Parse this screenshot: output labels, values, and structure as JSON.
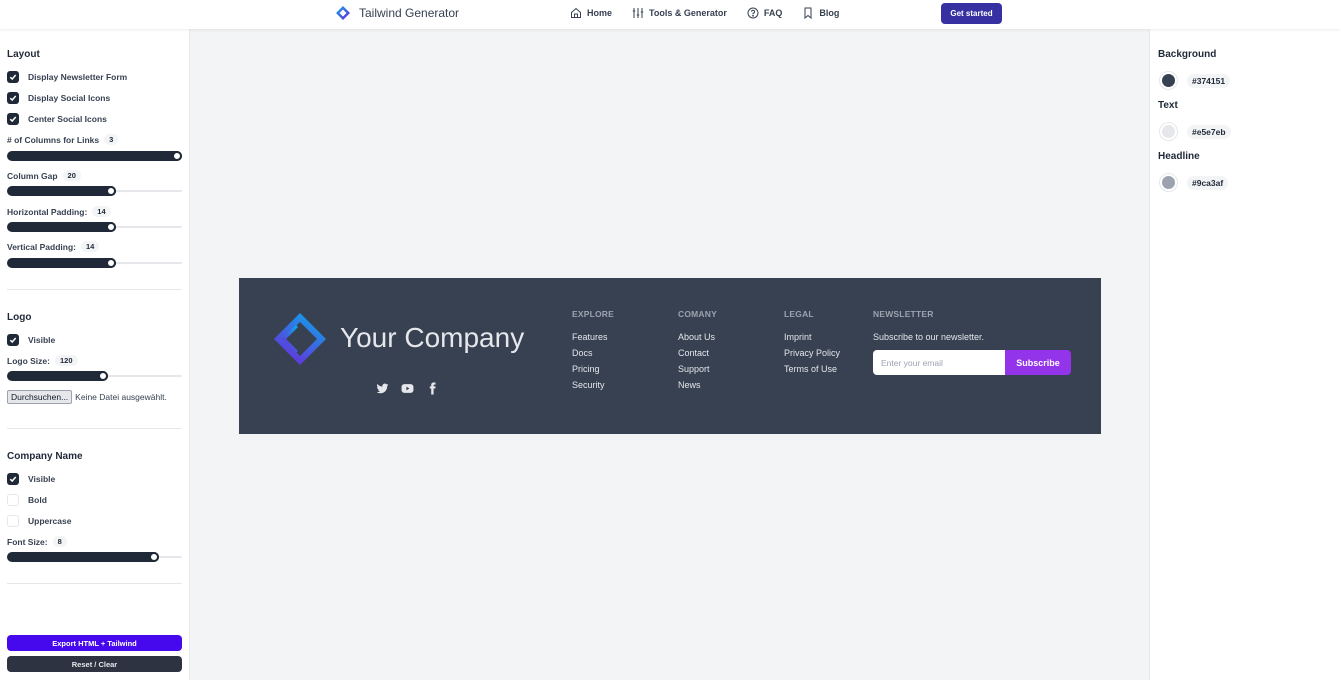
{
  "nav": {
    "brand": "Tailwind Generator",
    "links": [
      {
        "label": "Home",
        "icon": "home-icon"
      },
      {
        "label": "Tools & Generator",
        "icon": "sliders-icon"
      },
      {
        "label": "FAQ",
        "icon": "question-circle-icon"
      },
      {
        "label": "Blog",
        "icon": "bookmark-icon"
      }
    ],
    "cta": "Get started"
  },
  "left": {
    "layout": {
      "title": "Layout",
      "checkboxes": [
        {
          "label": "Display Newsletter Form",
          "checked": true
        },
        {
          "label": "Display Social Icons",
          "checked": true
        },
        {
          "label": "Center Social Icons",
          "checked": true
        }
      ],
      "sliders": [
        {
          "label": "# of Columns for Links",
          "value": "3",
          "fraction": 1.0
        },
        {
          "label": "Column Gap",
          "value": "20",
          "fraction": 0.6
        },
        {
          "label": "Horizontal Padding:",
          "value": "14",
          "fraction": 0.6
        },
        {
          "label": "Vertical Padding:",
          "value": "14",
          "fraction": 0.6
        }
      ]
    },
    "logo": {
      "title": "Logo",
      "visible_label": "Visible",
      "visible": true,
      "size_label": "Logo Size:",
      "size_value": "120",
      "size_fraction": 0.55,
      "file_button": "Durchsuchen...",
      "file_status": "Keine Datei ausgewählt."
    },
    "company": {
      "title": "Company Name",
      "checkboxes": [
        {
          "label": "Visible",
          "checked": true
        },
        {
          "label": "Bold",
          "checked": false
        },
        {
          "label": "Uppercase",
          "checked": false
        }
      ],
      "font_label": "Font Size:",
      "font_value": "8",
      "font_fraction": 0.86
    },
    "export_label": "Export HTML + Tailwind",
    "reset_label": "Reset / Clear"
  },
  "right": {
    "colors": [
      {
        "title": "Background",
        "hex": "#374151"
      },
      {
        "title": "Text",
        "hex": "#e5e7eb"
      },
      {
        "title": "Headline",
        "hex": "#9ca3af"
      }
    ]
  },
  "footer": {
    "company": "Your Company",
    "social": [
      "twitter-icon",
      "youtube-icon",
      "facebook-icon"
    ],
    "columns": [
      {
        "heading": "EXPLORE",
        "links": [
          "Features",
          "Docs",
          "Pricing",
          "Security"
        ]
      },
      {
        "heading": "COMANY",
        "links": [
          "About Us",
          "Contact",
          "Support",
          "News"
        ]
      },
      {
        "heading": "LEGAL",
        "links": [
          "Imprint",
          "Privacy Policy",
          "Terms of Use"
        ]
      }
    ],
    "newsletter": {
      "heading": "NEWSLETTER",
      "text": "Subscribe to our newsletter.",
      "placeholder": "Enter your email",
      "button": "Subscribe"
    }
  }
}
